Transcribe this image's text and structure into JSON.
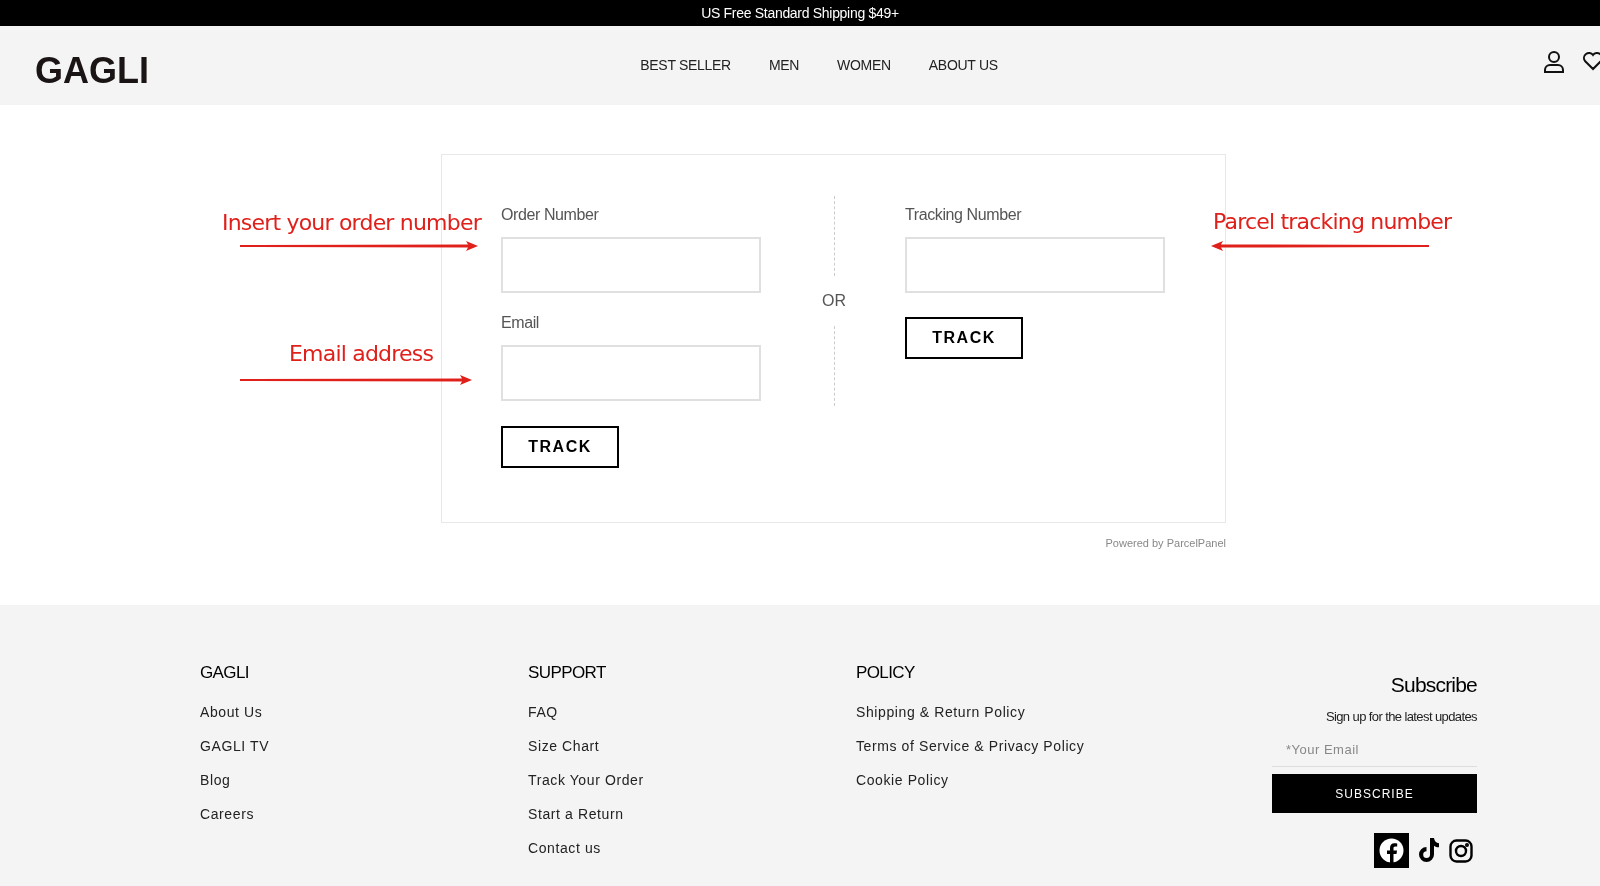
{
  "announcement": "US Free Standard Shipping $49+",
  "header": {
    "logo": "GAGLI",
    "nav": [
      "BEST SELLER",
      "MEN",
      "WOMEN",
      "ABOUT US"
    ]
  },
  "tracking_form": {
    "order": {
      "fields": [
        {
          "label": "Order Number"
        },
        {
          "label": "Email"
        }
      ],
      "button": "TRACK"
    },
    "separator": "OR",
    "tracking": {
      "fields": [
        {
          "label": "Tracking Number"
        }
      ],
      "button": "TRACK"
    },
    "powered_by": "Powered by ParcelPanel"
  },
  "annotations": [
    {
      "text": "Insert your order number",
      "kind": "right"
    },
    {
      "text": "Email address",
      "kind": "right"
    },
    {
      "text": "Parcel tracking number",
      "kind": "left"
    }
  ],
  "footer": {
    "columns": [
      {
        "heading": "GAGLI",
        "links": [
          "About Us",
          "GAGLI TV",
          "Blog",
          "Careers"
        ]
      },
      {
        "heading": "SUPPORT",
        "links": [
          "FAQ",
          "Size Chart",
          "Track Your Order",
          "Start a Return",
          "Contact us"
        ]
      },
      {
        "heading": "POLICY",
        "links": [
          "Shipping & Return Policy",
          "Terms of Service & Privacy Policy",
          "Cookie Policy"
        ]
      }
    ],
    "subscribe": {
      "heading": "Subscribe",
      "subtext": "Sign up for the latest updates",
      "placeholder": "*Your Email",
      "button": "SUBSCRIBE"
    }
  }
}
